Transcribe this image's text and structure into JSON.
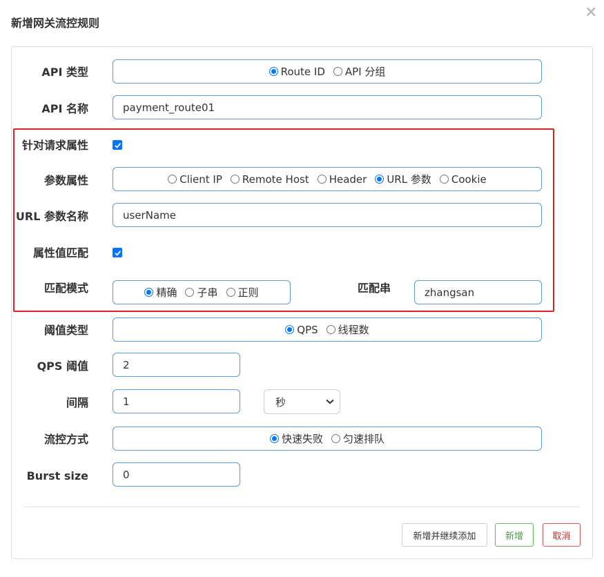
{
  "dialog": {
    "title": "新增网关流控规则",
    "close": "×"
  },
  "form": {
    "api_type": {
      "label": "API 类型",
      "options": [
        "Route ID",
        "API 分组"
      ],
      "selected": "Route ID"
    },
    "api_name": {
      "label": "API 名称",
      "value": "payment_route01"
    },
    "for_request_attr": {
      "label": "针对请求属性",
      "checked": true
    },
    "param_attr": {
      "label": "参数属性",
      "options": [
        "Client IP",
        "Remote Host",
        "Header",
        "URL 参数",
        "Cookie"
      ],
      "selected": "URL 参数"
    },
    "url_param_name": {
      "label": "URL 参数名称",
      "value": "userName"
    },
    "attr_value_match": {
      "label": "属性值匹配",
      "checked": true
    },
    "match_mode": {
      "label": "匹配模式",
      "options": [
        "精确",
        "子串",
        "正则"
      ],
      "selected": "精确"
    },
    "match_string": {
      "label": "匹配串",
      "value": "zhangsan"
    },
    "threshold_type": {
      "label": "阈值类型",
      "options": [
        "QPS",
        "线程数"
      ],
      "selected": "QPS"
    },
    "qps_threshold": {
      "label": "QPS 阈值",
      "value": "2"
    },
    "interval": {
      "label": "间隔",
      "value": "1",
      "unit": "秒"
    },
    "control_mode": {
      "label": "流控方式",
      "options": [
        "快速失败",
        "匀速排队"
      ],
      "selected": "快速失败"
    },
    "burst_size": {
      "label": "Burst size",
      "value": "0"
    }
  },
  "footer": {
    "continue_label": "新增并继续添加",
    "add_label": "新增",
    "cancel_label": "取消"
  },
  "colors": {
    "highlight_border": "#e02020",
    "input_border": "#5b9bd5",
    "radio_checked": "#0075ff"
  }
}
